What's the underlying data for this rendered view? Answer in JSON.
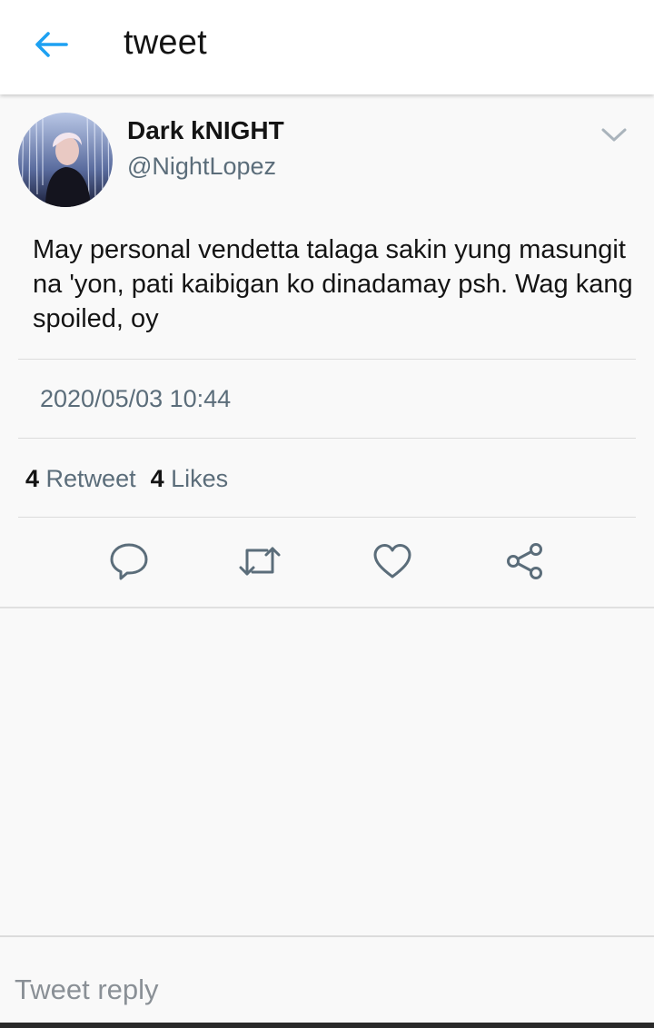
{
  "header": {
    "title": "tweet",
    "back_icon": "arrow-left-icon",
    "accent_color": "#1da1f2"
  },
  "tweet": {
    "display_name": "Dark kNIGHT",
    "handle": "@NightLopez",
    "text": "May personal vendetta talaga sakin yung masungit na 'yon, pati kaibigan ko dinadamay psh. Wag kang spoiled, oy",
    "timestamp": "2020/05/03 10:44",
    "retweet_count": "4",
    "retweet_label": "Retweet",
    "like_count": "4",
    "like_label": "Likes"
  },
  "actions": {
    "reply_icon": "comment-icon",
    "retweet_icon": "retweet-icon",
    "like_icon": "heart-icon",
    "share_icon": "share-icon",
    "icon_color": "#5b6d7a"
  },
  "reply": {
    "placeholder": "Tweet reply"
  }
}
